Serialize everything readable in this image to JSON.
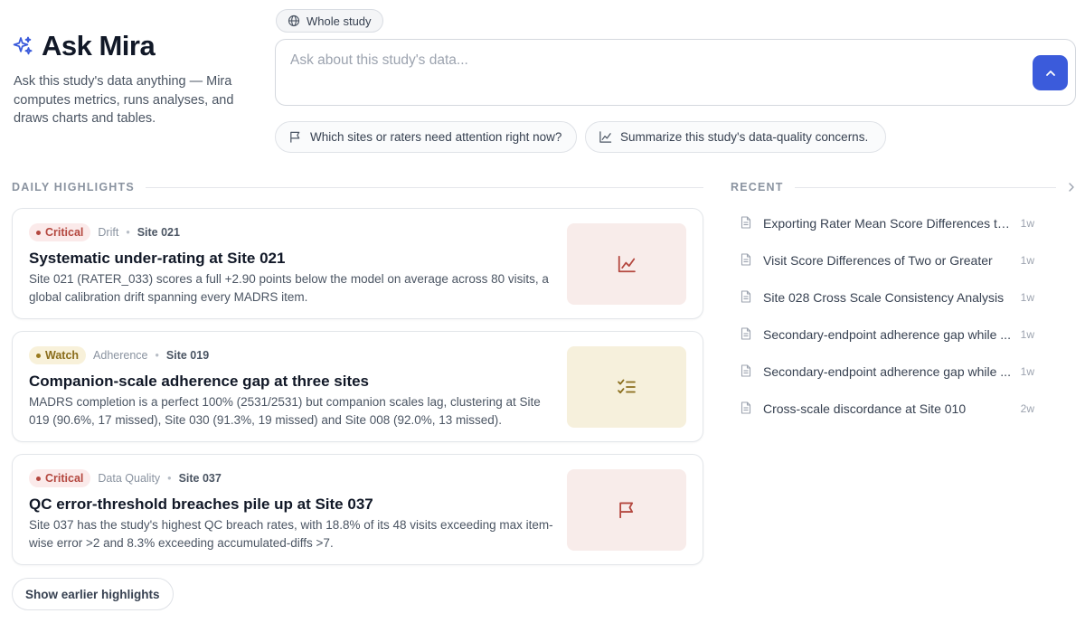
{
  "brand": {
    "name": "Ask Mira",
    "icon": "sparkle-icon"
  },
  "intro": "Ask this study's data anything — Mira computes metrics, runs analyses, and draws charts and tables.",
  "scope": {
    "label": "Whole study",
    "icon": "globe-icon"
  },
  "ask": {
    "placeholder": "Ask about this study's data...",
    "value": ""
  },
  "suggestions": [
    {
      "label": "Which sites or raters need attention right now?",
      "icon": "flag-icon"
    },
    {
      "label": "Summarize this study's data-quality concerns.",
      "icon": "chart-line-icon"
    }
  ],
  "daily": {
    "heading": "DAILY HIGHLIGHTS",
    "cards": [
      {
        "severity": "Critical",
        "category": "Drift",
        "site": "Site 021",
        "title": "Systematic under-rating at Site 021",
        "description": "Site 021 (RATER_033) scores a full +2.90 points below the model on average across 80 visits, a global calibration drift spanning every MADRS item.",
        "icon": "chart-line-icon",
        "accent": "#f8ecea"
      },
      {
        "severity": "Watch",
        "category": "Adherence",
        "site": "Site 019",
        "title": "Companion-scale adherence gap at three sites",
        "description": "MADRS completion is a perfect 100% (2531/2531) but companion scales lag, clustering at Site 019 (90.6%, 17 missed), Site 030 (91.3%, 19 missed) and Site 008 (92.0%, 13 missed).",
        "icon": "checklist-icon",
        "accent": "#f6f0dc"
      },
      {
        "severity": "Critical",
        "category": "Data Quality",
        "site": "Site 037",
        "title": "QC error-threshold breaches pile up at Site 037",
        "description": "Site 037 has the study's highest QC breach rates, with 18.8% of its 48 visits exceeding max item-wise error >2 and 8.3% exceeding accumulated-diffs >7.",
        "icon": "flag-icon",
        "accent": "#f8ecea"
      }
    ],
    "earlier_label": "Show earlier highlights"
  },
  "recent": {
    "heading": "RECENT",
    "items": [
      {
        "title": "Exporting Rater Mean Score Differences to...",
        "age": "1w"
      },
      {
        "title": "Visit Score Differences of Two or Greater",
        "age": "1w"
      },
      {
        "title": "Site 028 Cross Scale Consistency Analysis",
        "age": "1w"
      },
      {
        "title": "Secondary-endpoint adherence gap while ...",
        "age": "1w"
      },
      {
        "title": "Secondary-endpoint adherence gap while ...",
        "age": "1w"
      },
      {
        "title": "Cross-scale discordance at Site 010",
        "age": "2w"
      }
    ]
  },
  "colors": {
    "accent": "#3b5bdb",
    "critical": "#b4473f",
    "watch": "#8a6d1c"
  }
}
